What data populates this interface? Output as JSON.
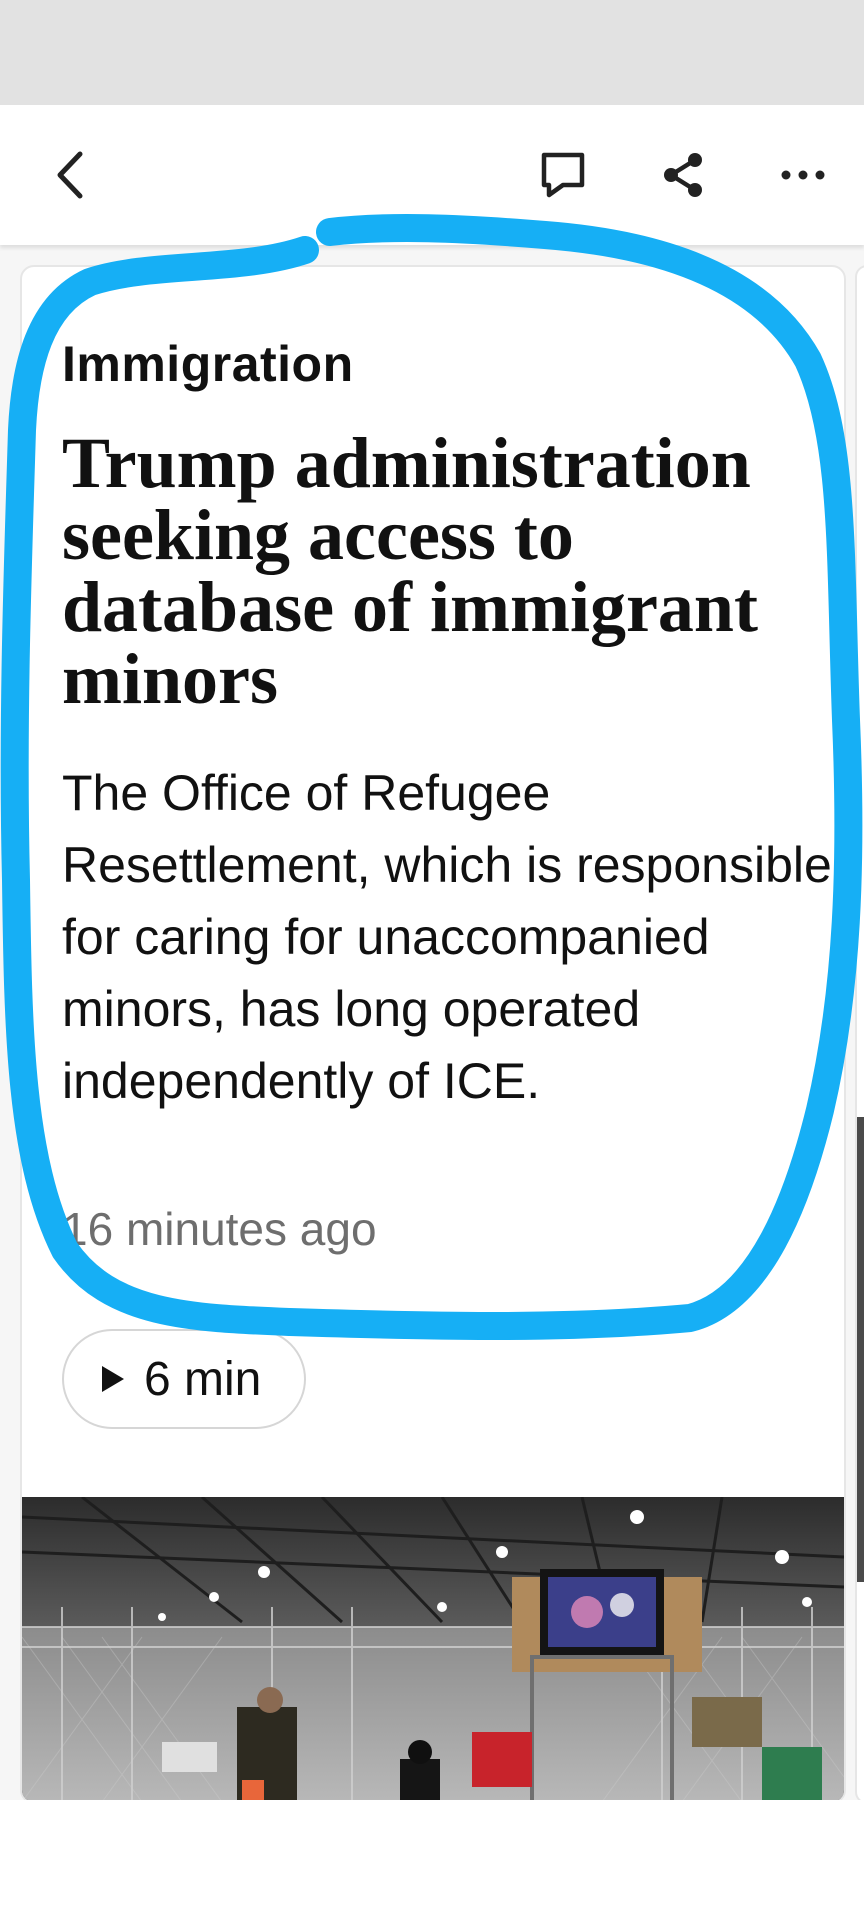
{
  "toolbar": {
    "back_icon": "back-arrow-icon",
    "comment_icon": "comment-icon",
    "share_icon": "share-icon",
    "more_icon": "more-icon"
  },
  "article": {
    "kicker": "Immigration",
    "headline": "Trump administration seeking access to database of immigrant minors",
    "blurb": "The Office of Refugee Resettlement, which is responsible for caring for unaccompanied minors, has long operated independently of ICE.",
    "timestamp": "16 minutes ago",
    "audio_duration": "6 min"
  },
  "colors": {
    "annotation_stroke": "#16aff5",
    "text": "#111111",
    "meta": "#6e6e6e"
  }
}
